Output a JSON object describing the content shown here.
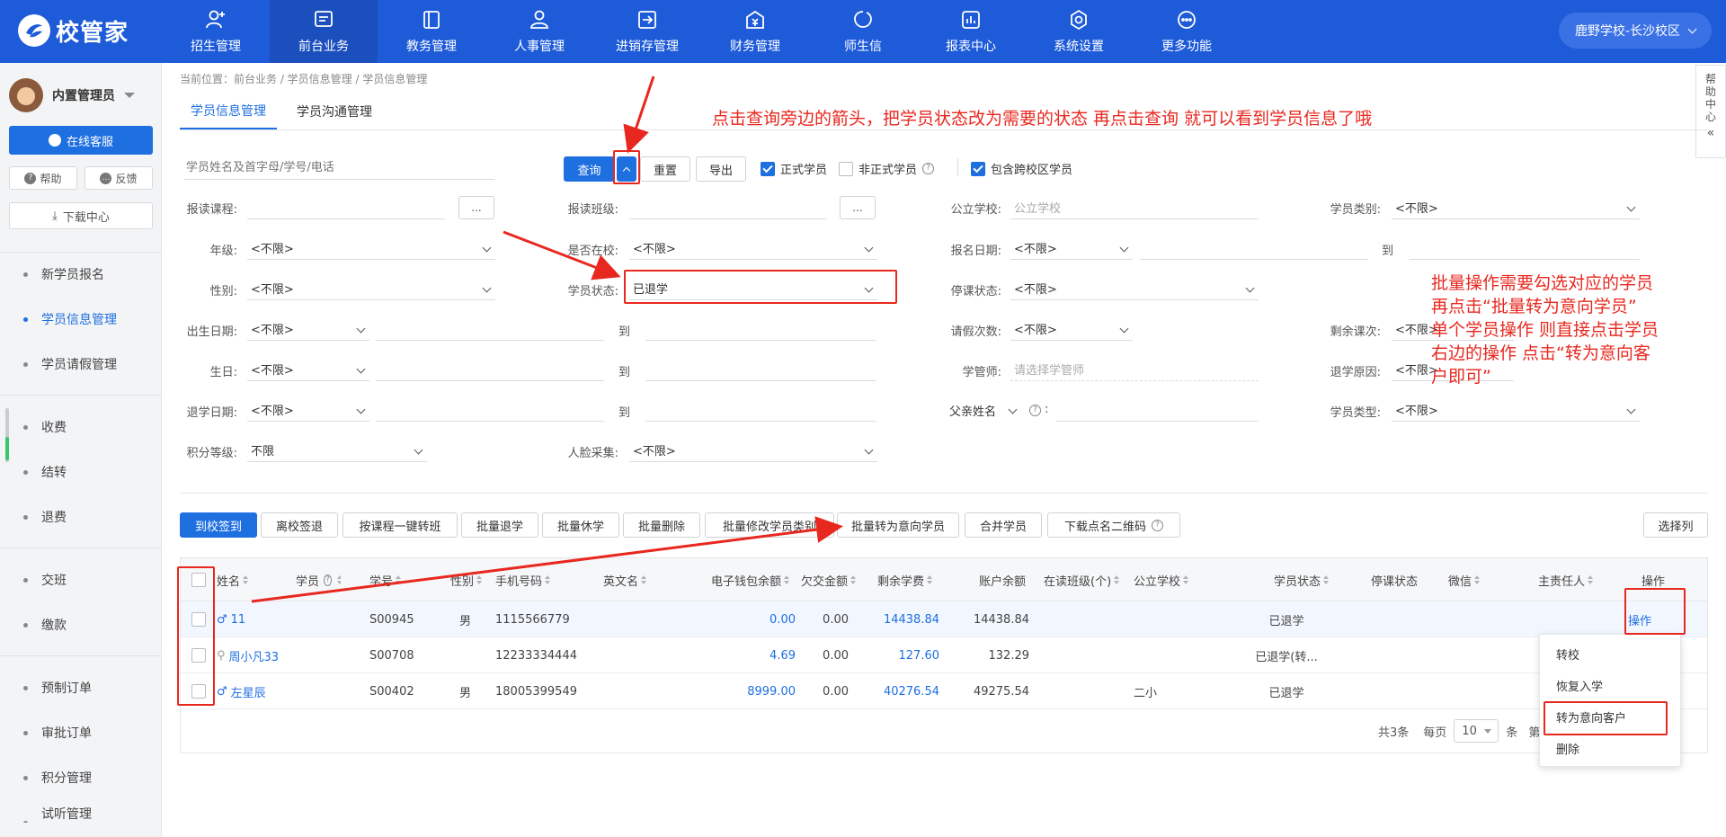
{
  "brand": {
    "name": "校管家"
  },
  "nav": [
    {
      "label": "招生管理",
      "icon": "add-user-icon"
    },
    {
      "label": "前台业务",
      "icon": "monitor-icon",
      "active": true
    },
    {
      "label": "教务管理",
      "icon": "book-icon"
    },
    {
      "label": "人事管理",
      "icon": "person-icon"
    },
    {
      "label": "进销存管理",
      "icon": "transfer-icon"
    },
    {
      "label": "财务管理",
      "icon": "money-icon"
    },
    {
      "label": "师生信",
      "icon": "chat-icon"
    },
    {
      "label": "报表中心",
      "icon": "report-icon"
    },
    {
      "label": "系统设置",
      "icon": "gear-icon"
    },
    {
      "label": "更多功能",
      "icon": "more-icon"
    }
  ],
  "campus": "鹿野学校-长沙校区",
  "sidebar": {
    "user": "内置管理员",
    "kefu": "在线客服",
    "help": "帮助",
    "feedback": "反馈",
    "download": "下载中心",
    "items": [
      "新学员报名",
      "学员信息管理",
      "学员请假管理",
      "收费",
      "结转",
      "退费",
      "交班",
      "缴款",
      "预制订单",
      "审批订单",
      "积分管理",
      "试听管理"
    ]
  },
  "help_center": [
    "帮",
    "助",
    "中",
    "心"
  ],
  "breadcrumb": "当前位置：前台业务 / 学员信息管理 / 学员信息管理",
  "tabs": [
    "学员信息管理",
    "学员沟通管理"
  ],
  "search": {
    "placeholder": "学员姓名及首字母/学号/电话",
    "query": "查询",
    "reset": "重置",
    "export": "导出",
    "formal": "正式学员",
    "informal": "非正式学员",
    "cross": "包含跨校区学员"
  },
  "filters": {
    "course": "报读课程:",
    "class": "报读班级:",
    "school": "公立学校:",
    "school_ph": "公立学校",
    "category": "学员类别:",
    "grade": "年级:",
    "inschool": "是否在校:",
    "signdate": "报名日期:",
    "gender": "性别:",
    "status": "学员状态:",
    "status_value": "已退学",
    "suspend": "停课状态:",
    "birthdate": "出生日期:",
    "leaves": "请假次数:",
    "remain": "剩余课次:",
    "birthday": "生日:",
    "manager": "学管师:",
    "manager_ph": "请选择学管师",
    "reason": "退学原因:",
    "quitdate": "退学日期:",
    "father": "父亲姓名",
    "type": "学员类型:",
    "points": "积分等级:",
    "points_value": "不限",
    "face": "人脸采集:",
    "any": "<不限>",
    "to": "到",
    "dots": "...",
    "colon": ":"
  },
  "actions": [
    "到校签到",
    "离校签退",
    "按课程一键转班",
    "批量退学",
    "批量休学",
    "批量删除",
    "批量修改学员类别",
    "批量转为意向学员",
    "合并学员",
    "下载点名二维码"
  ],
  "choose_cols": "选择列",
  "table": {
    "headers": [
      "姓名",
      "学员",
      "学号",
      "性别",
      "手机号码",
      "英文名",
      "电子钱包余额",
      "欠交金额",
      "剩余学费",
      "账户余额",
      "在读班级(个)",
      "公立学校",
      "学员状态",
      "停课状态",
      "微信",
      "主责任人",
      "操作"
    ],
    "rows": [
      {
        "name": "11",
        "no": "S00945",
        "sex": "男",
        "phone": "1115566779",
        "wallet": "0.00",
        "owed": "0.00",
        "fee": "14438.84",
        "balance": "14438.84",
        "school": "",
        "status": "已退学",
        "op": "操作"
      },
      {
        "name": "周小凡33",
        "no": "S00708",
        "sex": "",
        "phone": "12233334444",
        "wallet": "4.69",
        "owed": "0.00",
        "fee": "127.60",
        "balance": "132.29",
        "school": "",
        "status": "已退学(转...",
        "op": ""
      },
      {
        "name": "左星辰",
        "no": "S00402",
        "sex": "男",
        "phone": "18005399549",
        "wallet": "8999.00",
        "owed": "0.00",
        "fee": "40276.54",
        "balance": "49275.54",
        "school": "二小",
        "status": "已退学",
        "op": ""
      }
    ]
  },
  "pager": {
    "total": "共3条",
    "per_page": "每页",
    "size": "10",
    "unit": "条",
    "page": "第"
  },
  "op_menu": [
    "转校",
    "恢复入学",
    "转为意向客户",
    "删除"
  ],
  "annotations": {
    "top": "点击查询旁边的箭头，把学员状态改为需要的状态 再点击查询 就可以看到学员信息了哦",
    "right": [
      "批量操作需要勾选对应的学员",
      "再点击“批量转为意向学员”",
      "单个学员操作 则直接点击学员",
      "右边的操作 点击“转为意向客",
      "户即可”"
    ]
  },
  "colors": {
    "primary": "#1e5bd8",
    "accent": "#1e6fe0",
    "annotation": "#e8281f"
  }
}
